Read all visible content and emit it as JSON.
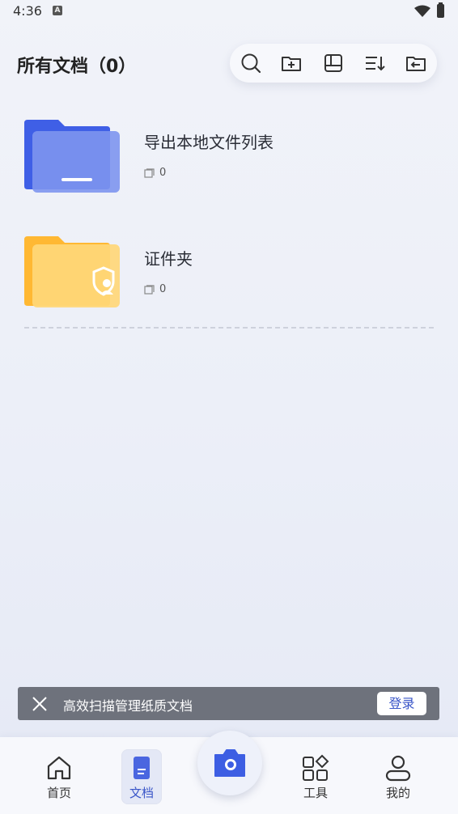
{
  "status_bar": {
    "time": "4:36",
    "notification_glyph": "A"
  },
  "header": {
    "title": "所有文档（0）"
  },
  "toolbar": {
    "icons": [
      "search-icon",
      "add-folder-icon",
      "layout-icon",
      "sort-icon",
      "import-icon"
    ]
  },
  "folders": [
    {
      "name": "导出本地文件列表",
      "count": "0",
      "color": "#4f6ee0",
      "icon": "folder-icon"
    },
    {
      "name": "证件夹",
      "count": "0",
      "color": "#ffc84a",
      "icon": "id-folder-icon"
    }
  ],
  "banner": {
    "text": "高效扫描管理纸质文档",
    "login_label": "登录"
  },
  "bottom_nav": {
    "items": [
      {
        "label": "首页",
        "icon": "home-icon"
      },
      {
        "label": "文档",
        "icon": "document-icon",
        "active": true
      },
      {
        "label": "工具",
        "icon": "tools-icon"
      },
      {
        "label": "我的",
        "icon": "profile-icon"
      }
    ],
    "camera_icon": "camera-icon"
  },
  "colors": {
    "accent": "#3a56c8",
    "banner_bg": "#6e727c"
  }
}
